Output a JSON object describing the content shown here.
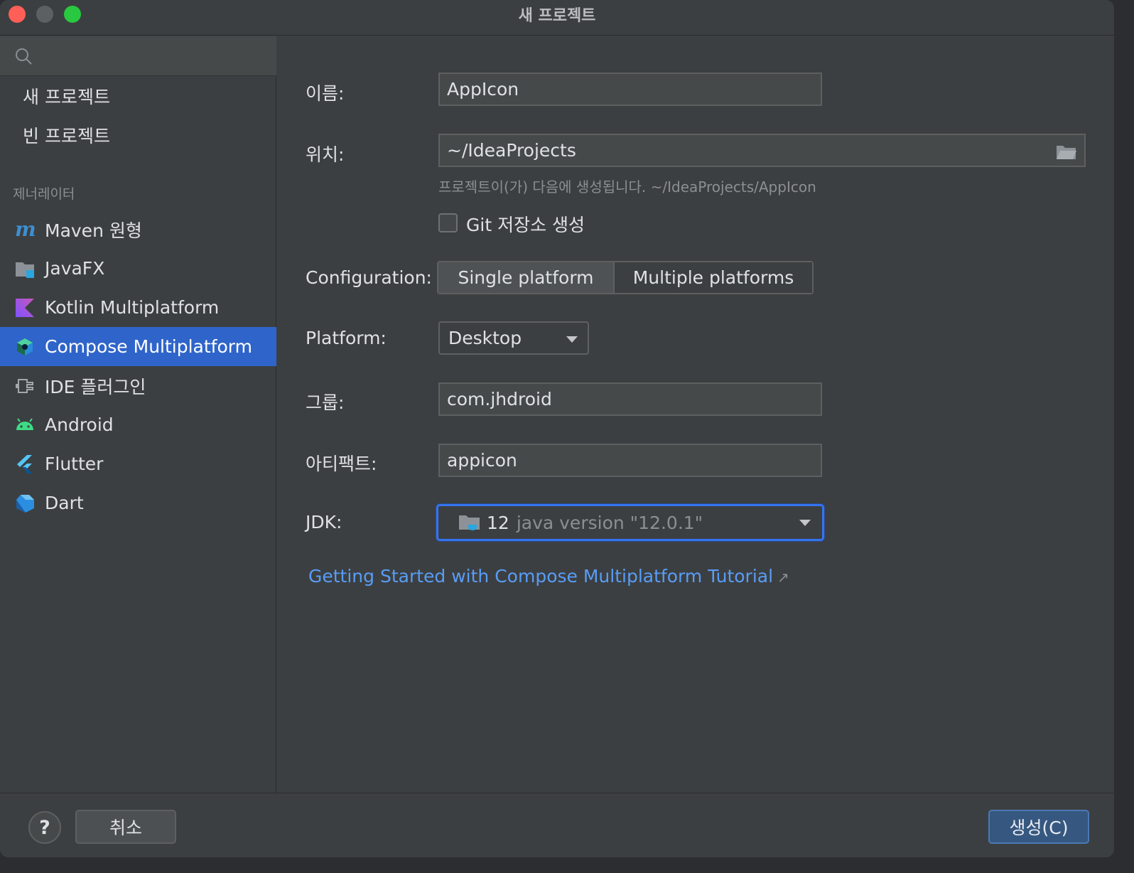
{
  "window": {
    "title": "새 프로젝트"
  },
  "sidebar": {
    "search_placeholder": "",
    "top_items": [
      {
        "label": "새 프로젝트"
      },
      {
        "label": "빈 프로젝트"
      }
    ],
    "generators_label": "제너레이터",
    "generators": [
      {
        "label": "Maven 원형",
        "icon": "maven-icon"
      },
      {
        "label": "JavaFX",
        "icon": "javafx-icon"
      },
      {
        "label": "Kotlin Multiplatform",
        "icon": "kotlin-icon"
      },
      {
        "label": "Compose Multiplatform",
        "icon": "compose-icon",
        "selected": true
      },
      {
        "label": "IDE 플러그인",
        "icon": "plugin-icon"
      },
      {
        "label": "Android",
        "icon": "android-icon"
      },
      {
        "label": "Flutter",
        "icon": "flutter-icon"
      },
      {
        "label": "Dart",
        "icon": "dart-icon"
      }
    ]
  },
  "form": {
    "name": {
      "label": "이름:",
      "value": "AppIcon"
    },
    "location": {
      "label": "위치:",
      "value": "~/IdeaProjects",
      "hint": "프로젝트이(가) 다음에 생성됩니다. ~/IdeaProjects/AppIcon"
    },
    "git": {
      "label": "Git 저장소 생성",
      "checked": false
    },
    "configuration": {
      "label": "Configuration:",
      "options": [
        "Single platform",
        "Multiple platforms"
      ],
      "selected": "Single platform"
    },
    "platform": {
      "label": "Platform:",
      "value": "Desktop"
    },
    "group": {
      "label": "그룹:",
      "value": "com.jhdroid"
    },
    "artifact": {
      "label": "아티팩트:",
      "value": "appicon"
    },
    "jdk": {
      "label": "JDK:",
      "version": "12",
      "description": "java version \"12.0.1\""
    },
    "tutorial_link": "Getting Started with Compose Multiplatform Tutorial",
    "tutorial_arrow": "↗"
  },
  "footer": {
    "help": "?",
    "cancel": "취소",
    "create": "생성(C)"
  },
  "colors": {
    "accent": "#2f65ca",
    "link": "#589df6",
    "focus": "#3574f0"
  }
}
